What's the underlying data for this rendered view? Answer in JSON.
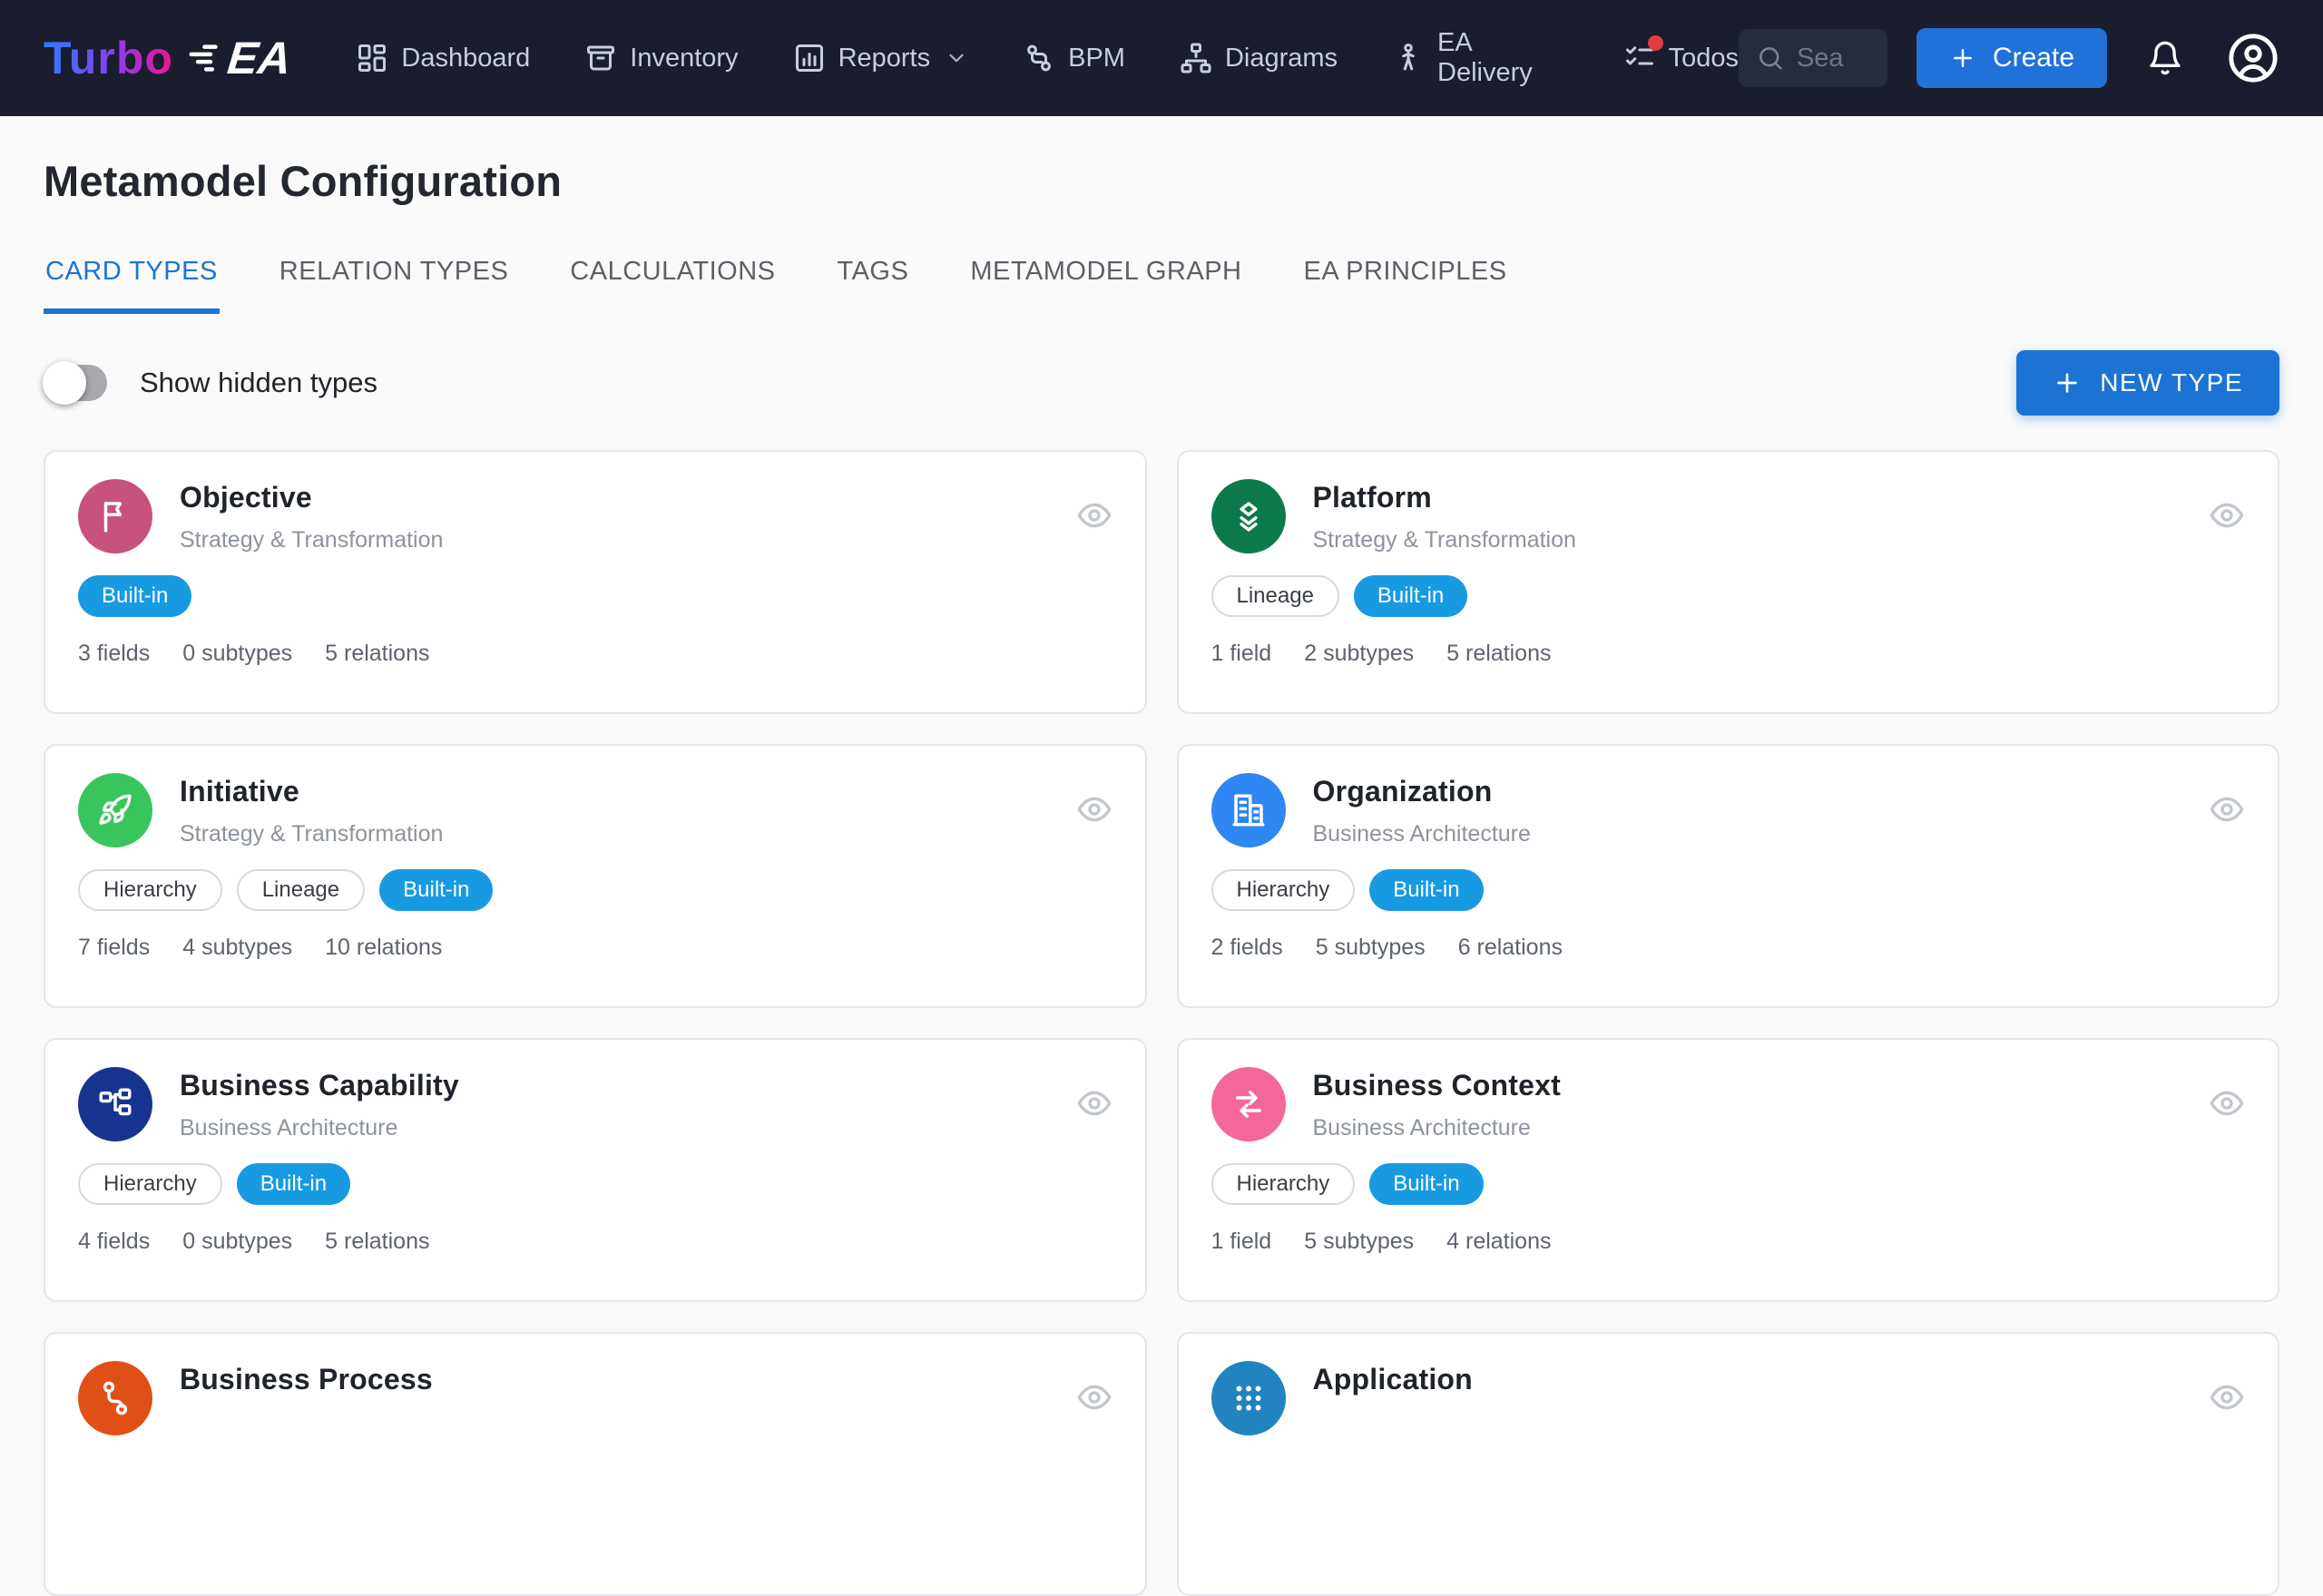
{
  "nav": {
    "logo": {
      "turbo": "Turbo",
      "ea": "EA"
    },
    "items": [
      {
        "label": "Dashboard",
        "icon": "dashboard-icon"
      },
      {
        "label": "Inventory",
        "icon": "inventory-icon"
      },
      {
        "label": "Reports",
        "icon": "reports-icon",
        "has_dropdown": true
      },
      {
        "label": "BPM",
        "icon": "bpm-icon"
      },
      {
        "label": "Diagrams",
        "icon": "diagrams-icon"
      },
      {
        "label": "EA Delivery",
        "icon": "ea-delivery-icon"
      },
      {
        "label": "Todos",
        "icon": "todos-icon",
        "badge_dot": true
      }
    ],
    "search": {
      "placeholder": "Sea"
    },
    "create_label": "Create"
  },
  "page": {
    "title": "Metamodel Configuration"
  },
  "tabs": [
    {
      "label": "CARD TYPES",
      "active": true
    },
    {
      "label": "RELATION TYPES"
    },
    {
      "label": "CALCULATIONS"
    },
    {
      "label": "TAGS"
    },
    {
      "label": "METAMODEL GRAPH"
    },
    {
      "label": "EA PRINCIPLES"
    }
  ],
  "toolbar": {
    "toggle_label": "Show hidden types",
    "toggle_on": false,
    "new_type_label": "NEW TYPE"
  },
  "colors": {
    "navbar": "#1a1d2d",
    "accent": "#1b74d4",
    "badge_blue": "#189ae3",
    "notification_dot": "#e23b3f"
  },
  "cards": [
    {
      "title": "Objective",
      "subtitle": "Strategy & Transformation",
      "icon": "flag-icon",
      "color": "#c7527e",
      "badges": [
        {
          "label": "Built-in",
          "variant": "solid"
        }
      ],
      "stats": [
        "3 fields",
        "0 subtypes",
        "5 relations"
      ]
    },
    {
      "title": "Platform",
      "subtitle": "Strategy & Transformation",
      "icon": "layers-icon",
      "color": "#0c7a4c",
      "badges": [
        {
          "label": "Lineage",
          "variant": "outline"
        },
        {
          "label": "Built-in",
          "variant": "solid"
        }
      ],
      "stats": [
        "1 field",
        "2 subtypes",
        "5 relations"
      ]
    },
    {
      "title": "Initiative",
      "subtitle": "Strategy & Transformation",
      "icon": "rocket-icon",
      "color": "#38c65c",
      "badges": [
        {
          "label": "Hierarchy",
          "variant": "outline"
        },
        {
          "label": "Lineage",
          "variant": "outline"
        },
        {
          "label": "Built-in",
          "variant": "solid"
        }
      ],
      "stats": [
        "7 fields",
        "4 subtypes",
        "10 relations"
      ]
    },
    {
      "title": "Organization",
      "subtitle": "Business Architecture",
      "icon": "building-icon",
      "color": "#2e87f2",
      "badges": [
        {
          "label": "Hierarchy",
          "variant": "outline"
        },
        {
          "label": "Built-in",
          "variant": "solid"
        }
      ],
      "stats": [
        "2 fields",
        "5 subtypes",
        "6 relations"
      ]
    },
    {
      "title": "Business Capability",
      "subtitle": "Business Architecture",
      "icon": "sitemap-icon",
      "color": "#173490",
      "badges": [
        {
          "label": "Hierarchy",
          "variant": "outline"
        },
        {
          "label": "Built-in",
          "variant": "solid"
        }
      ],
      "stats": [
        "4 fields",
        "0 subtypes",
        "5 relations"
      ]
    },
    {
      "title": "Business Context",
      "subtitle": "Business Architecture",
      "icon": "swap-arrows-icon",
      "color": "#f4679a",
      "badges": [
        {
          "label": "Hierarchy",
          "variant": "outline"
        },
        {
          "label": "Built-in",
          "variant": "solid"
        }
      ],
      "stats": [
        "1 field",
        "5 subtypes",
        "4 relations"
      ]
    },
    {
      "title": "Business Process",
      "icon": "workflow-icon",
      "color": "#e05016",
      "badges": [],
      "stats": []
    },
    {
      "title": "Application",
      "icon": "app-grid-icon",
      "color": "#2184bf",
      "badges": [],
      "stats": []
    }
  ]
}
